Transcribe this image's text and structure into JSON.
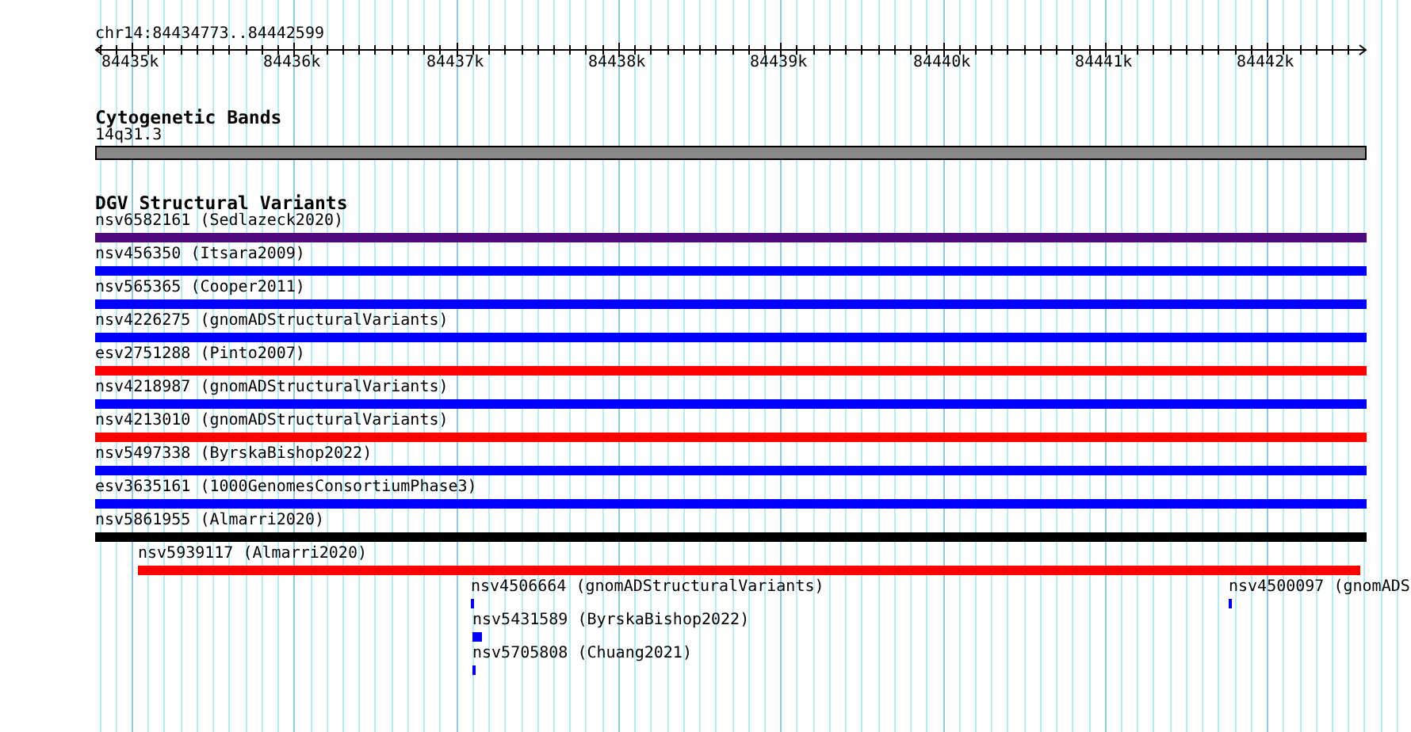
{
  "location": "chr14:84434773..84442599",
  "ruler": {
    "ticks": [
      "84435k",
      "84436k",
      "84437k",
      "84438k",
      "84439k",
      "84440k",
      "84441k",
      "84442k"
    ]
  },
  "tracks": [
    {
      "title": "Cytogenetic Bands",
      "features": [
        {
          "label": "14q31.3",
          "color": "#888888"
        }
      ]
    },
    {
      "title": "DGV Structural Variants",
      "features": [
        {
          "label": "nsv6582161 (Sedlazeck2020)",
          "color": "#4f087e"
        },
        {
          "label": "nsv456350 (Itsara2009)",
          "color": "#0000ff"
        },
        {
          "label": "nsv565365 (Cooper2011)",
          "color": "#0000ff"
        },
        {
          "label": "nsv4226275 (gnomADStructuralVariants)",
          "color": "#0000ff"
        },
        {
          "label": "esv2751288 (Pinto2007)",
          "color": "#ff0000"
        },
        {
          "label": "nsv4218987 (gnomADStructuralVariants)",
          "color": "#0000ff"
        },
        {
          "label": "nsv4213010 (gnomADStructuralVariants)",
          "color": "#ff0000"
        },
        {
          "label": "nsv5497338 (ByrskaBishop2022)",
          "color": "#0000ff"
        },
        {
          "label": "esv3635161 (1000GenomesConsortiumPhase3)",
          "color": "#0000ff"
        },
        {
          "label": "nsv5861955 (Almarri2020)",
          "color": "#000000"
        },
        {
          "label": "nsv5939117 (Almarri2020)",
          "color": "#ff0000"
        },
        {
          "label": "nsv4506664 (gnomADStructuralVariants)",
          "color": "#0000ff"
        },
        {
          "label": "nsv4500097 (gnomADS",
          "color": "#0000ff"
        },
        {
          "label": "nsv5431589 (ByrskaBishop2022)",
          "color": "#0000ff"
        },
        {
          "label": "nsv5705808 (Chuang2021)",
          "color": "#0000ff"
        }
      ]
    }
  ]
}
